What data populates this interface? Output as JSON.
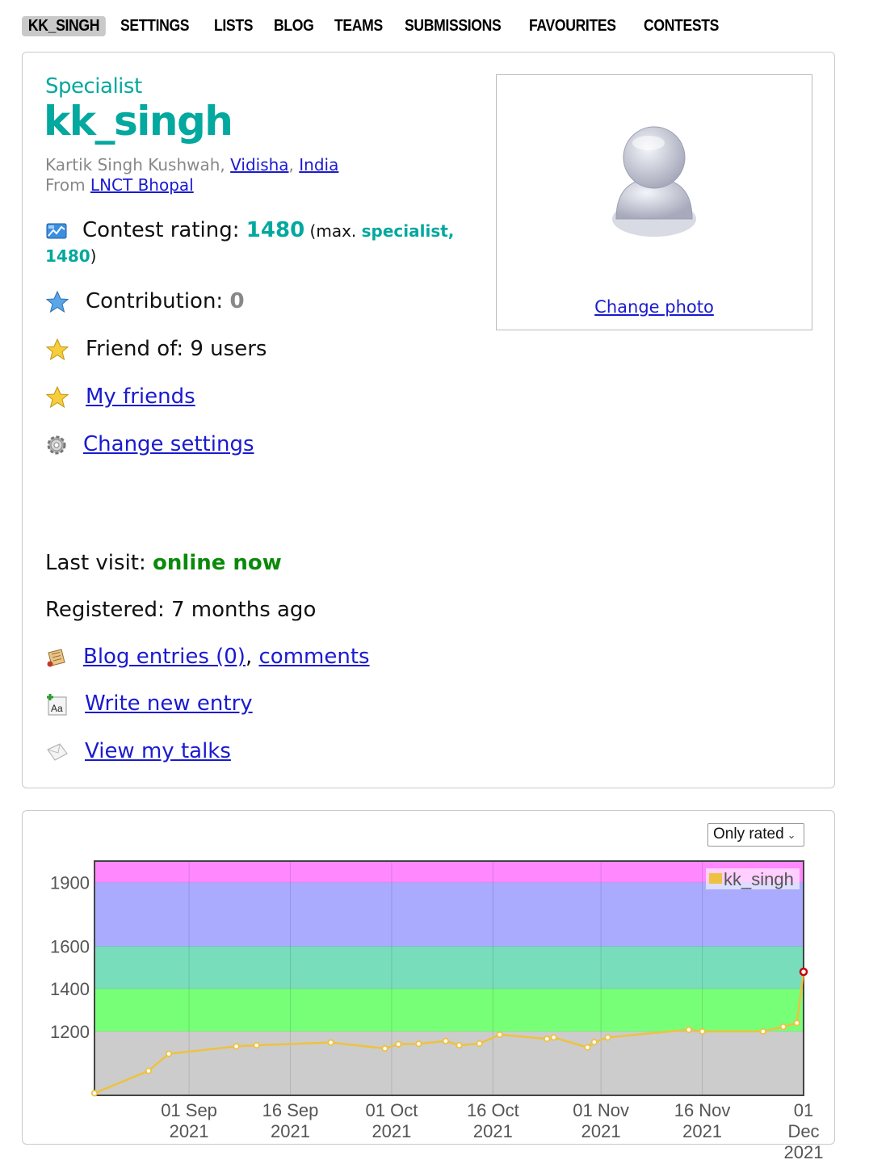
{
  "nav": [
    {
      "label": "KK_SINGH",
      "active": true
    },
    {
      "label": "SETTINGS"
    },
    {
      "label": "LISTS"
    },
    {
      "label": "BLOG"
    },
    {
      "label": "TEAMS"
    },
    {
      "label": "SUBMISSIONS"
    },
    {
      "label": "FAVOURITES"
    },
    {
      "label": "CONTESTS"
    }
  ],
  "profile": {
    "rank": "Specialist",
    "handle": "kk_singh",
    "name_prefix": "Kartik Singh Kushwah, ",
    "city": "Vidisha",
    "comma": ", ",
    "country": "India",
    "from_label": "From ",
    "organization": "LNCT Bhopal",
    "rating_label": "Contest rating: ",
    "rating": "1480",
    "max_open": " (max. ",
    "max_rank": "specialist,",
    "max_rating": "1480",
    "max_close": ")",
    "contribution_label": "Contribution: ",
    "contribution": "0",
    "friend_of": "Friend of: 9 users",
    "my_friends": "My friends",
    "change_settings": "Change settings",
    "last_visit_label": "Last visit: ",
    "last_visit": "online now",
    "registered": "Registered: 7 months ago",
    "blog_entries": "Blog entries (0)",
    "comments_sep": ", ",
    "comments": "comments",
    "write_entry": "Write new entry",
    "view_talks": "View my talks",
    "change_photo": "Change photo"
  },
  "icons": {
    "rating": "rating-chart-icon",
    "contribution": "blue-star-icon",
    "friend_of": "gold-star-icon",
    "my_friends": "gold-star-icon",
    "settings": "gear-icon",
    "blog": "blog-scroll-icon",
    "write": "write-entry-icon",
    "talks": "envelope-icon",
    "avatar": "user-avatar-icon"
  },
  "graph": {
    "filter_value": "Only rated"
  },
  "chart_data": {
    "type": "line",
    "legend": "kk_singh",
    "legend_position": "top-right",
    "grid": true,
    "y_ticks": [
      1200,
      1400,
      1600,
      1900
    ],
    "x_ticks": [
      {
        "date": "2021-09-01",
        "lines": [
          "01 Sep",
          "2021"
        ]
      },
      {
        "date": "2021-09-16",
        "lines": [
          "16 Sep",
          "2021"
        ]
      },
      {
        "date": "2021-10-01",
        "lines": [
          "01 Oct",
          "2021"
        ]
      },
      {
        "date": "2021-10-16",
        "lines": [
          "16 Oct",
          "2021"
        ]
      },
      {
        "date": "2021-11-01",
        "lines": [
          "01 Nov",
          "2021"
        ]
      },
      {
        "date": "2021-11-16",
        "lines": [
          "16 Nov",
          "2021"
        ]
      },
      {
        "date": "2021-12-01",
        "lines": [
          "01",
          "Dec",
          "2021"
        ]
      }
    ],
    "x_range": [
      "2021-08-18",
      "2021-12-01"
    ],
    "y_range": [
      900,
      2000
    ],
    "bands": [
      {
        "from": 900,
        "to": 1200,
        "color": "#cccccc"
      },
      {
        "from": 1200,
        "to": 1400,
        "color": "#77ff77"
      },
      {
        "from": 1400,
        "to": 1600,
        "color": "#77ddbb"
      },
      {
        "from": 1600,
        "to": 1900,
        "color": "#aaaaff"
      },
      {
        "from": 1900,
        "to": 2000,
        "color": "#ff88ff"
      }
    ],
    "line_color": "#edc240",
    "series": [
      {
        "name": "kk_singh",
        "points": [
          [
            "2021-08-18",
            910
          ],
          [
            "2021-08-26",
            1015
          ],
          [
            "2021-08-29",
            1095
          ],
          [
            "2021-09-08",
            1130
          ],
          [
            "2021-09-11",
            1135
          ],
          [
            "2021-09-22",
            1148
          ],
          [
            "2021-09-30",
            1120
          ],
          [
            "2021-10-02",
            1140
          ],
          [
            "2021-10-05",
            1142
          ],
          [
            "2021-10-09",
            1155
          ],
          [
            "2021-10-11",
            1135
          ],
          [
            "2021-10-14",
            1143
          ],
          [
            "2021-10-17",
            1185
          ],
          [
            "2021-10-24",
            1165
          ],
          [
            "2021-10-25",
            1172
          ],
          [
            "2021-10-30",
            1125
          ],
          [
            "2021-10-31",
            1150
          ],
          [
            "2021-11-02",
            1172
          ],
          [
            "2021-11-14",
            1208
          ],
          [
            "2021-11-16",
            1200
          ],
          [
            "2021-11-25",
            1200
          ],
          [
            "2021-11-28",
            1222
          ],
          [
            "2021-11-30",
            1240
          ],
          [
            "2021-12-01",
            1480
          ]
        ]
      }
    ]
  }
}
